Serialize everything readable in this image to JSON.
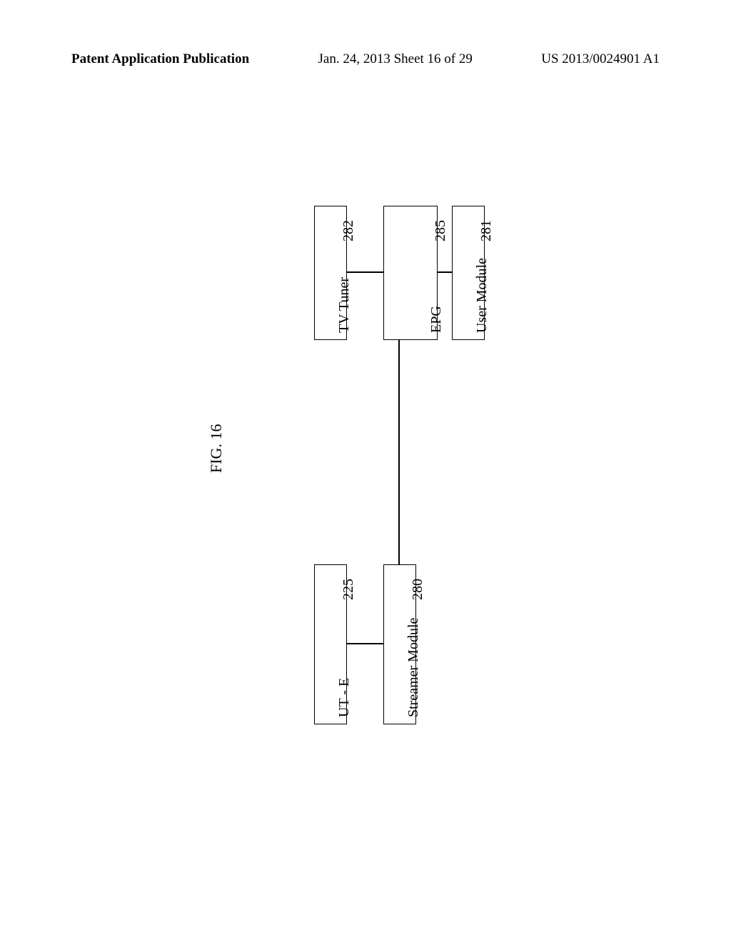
{
  "header": {
    "left": "Patent Application Publication",
    "center": "Jan. 24, 2013  Sheet 16 of 29",
    "right": "US 2013/0024901 A1"
  },
  "figure_label": "FIG. 16",
  "boxes": {
    "user_module": {
      "label": "User Module",
      "num": "281"
    },
    "epg": {
      "label": "EPG",
      "num": "285"
    },
    "tv_tuner": {
      "label": "TV Tuner",
      "num": "282"
    },
    "streamer": {
      "label": "Streamer Module",
      "num": "280"
    },
    "ute": {
      "label": "UT - E",
      "num": "225"
    }
  }
}
